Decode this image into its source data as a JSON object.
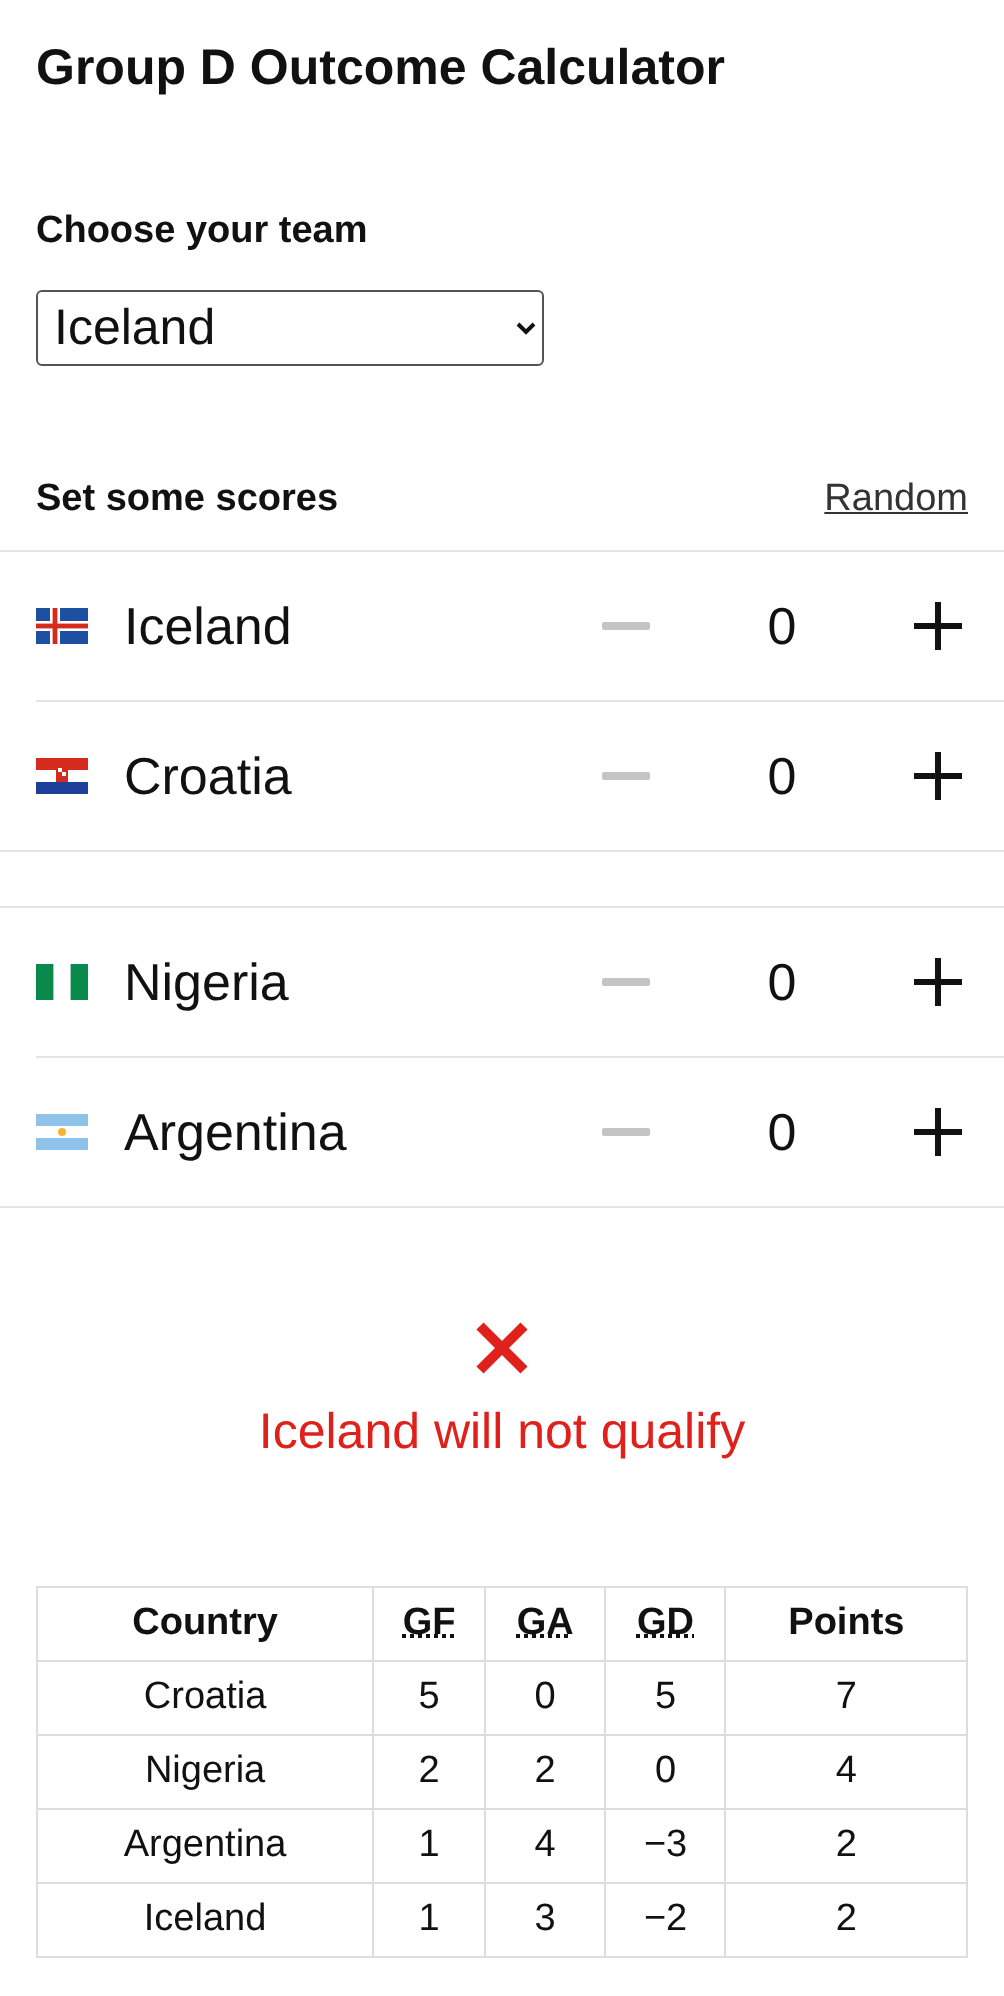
{
  "title": "Group D Outcome Calculator",
  "team_select": {
    "label": "Choose your team",
    "value": "Iceland"
  },
  "scores": {
    "heading": "Set some scores",
    "random_link": "Random",
    "matches": [
      {
        "teams": [
          {
            "name": "Iceland",
            "score": "0",
            "minus_disabled": true
          },
          {
            "name": "Croatia",
            "score": "0",
            "minus_disabled": true
          }
        ]
      },
      {
        "teams": [
          {
            "name": "Nigeria",
            "score": "0",
            "minus_disabled": true
          },
          {
            "name": "Argentina",
            "score": "0",
            "minus_disabled": true
          }
        ]
      }
    ]
  },
  "result": {
    "qualifies": false,
    "message": "Iceland will not qualify"
  },
  "table": {
    "columns": [
      {
        "label": "Country",
        "abbr": false
      },
      {
        "label": "GF",
        "abbr": true
      },
      {
        "label": "GA",
        "abbr": true
      },
      {
        "label": "GD",
        "abbr": true
      },
      {
        "label": "Points",
        "abbr": false
      }
    ],
    "rows": [
      [
        "Croatia",
        "5",
        "0",
        "5",
        "7"
      ],
      [
        "Nigeria",
        "2",
        "2",
        "0",
        "4"
      ],
      [
        "Argentina",
        "1",
        "4",
        "−3",
        "2"
      ],
      [
        "Iceland",
        "1",
        "3",
        "−2",
        "2"
      ]
    ]
  }
}
